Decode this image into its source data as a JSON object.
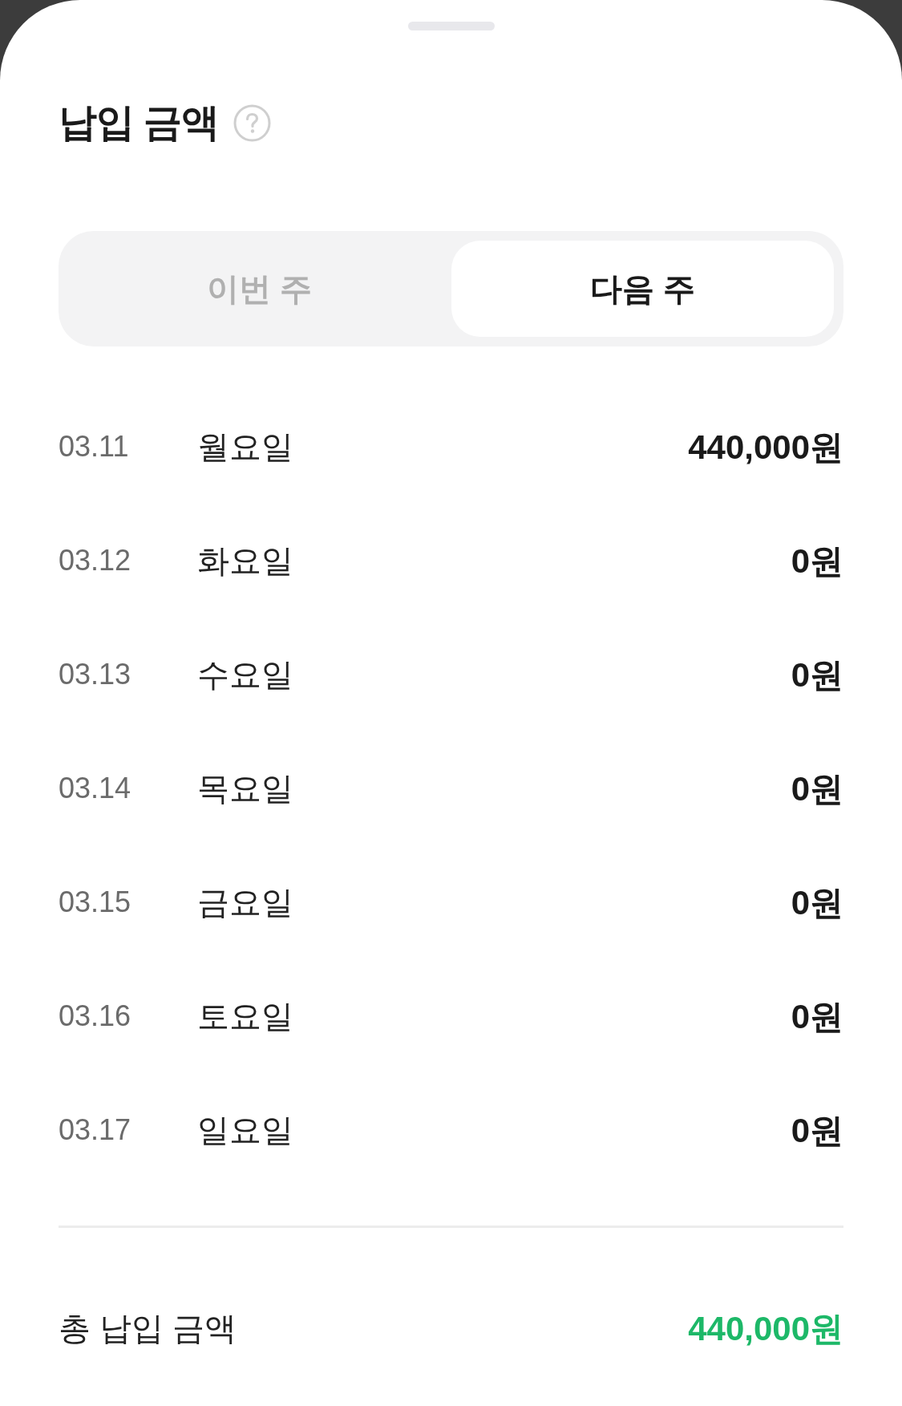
{
  "sheet": {
    "title": "납입 금액"
  },
  "tabs": [
    {
      "label": "이번 주",
      "selected": false
    },
    {
      "label": "다음 주",
      "selected": true
    }
  ],
  "rows": [
    {
      "date": "03.11",
      "day": "월요일",
      "amount": "440,000원"
    },
    {
      "date": "03.12",
      "day": "화요일",
      "amount": "0원"
    },
    {
      "date": "03.13",
      "day": "수요일",
      "amount": "0원"
    },
    {
      "date": "03.14",
      "day": "목요일",
      "amount": "0원"
    },
    {
      "date": "03.15",
      "day": "금요일",
      "amount": "0원"
    },
    {
      "date": "03.16",
      "day": "토요일",
      "amount": "0원"
    },
    {
      "date": "03.17",
      "day": "일요일",
      "amount": "0원"
    }
  ],
  "total": {
    "label": "총 납입 금액",
    "amount": "440,000원"
  }
}
